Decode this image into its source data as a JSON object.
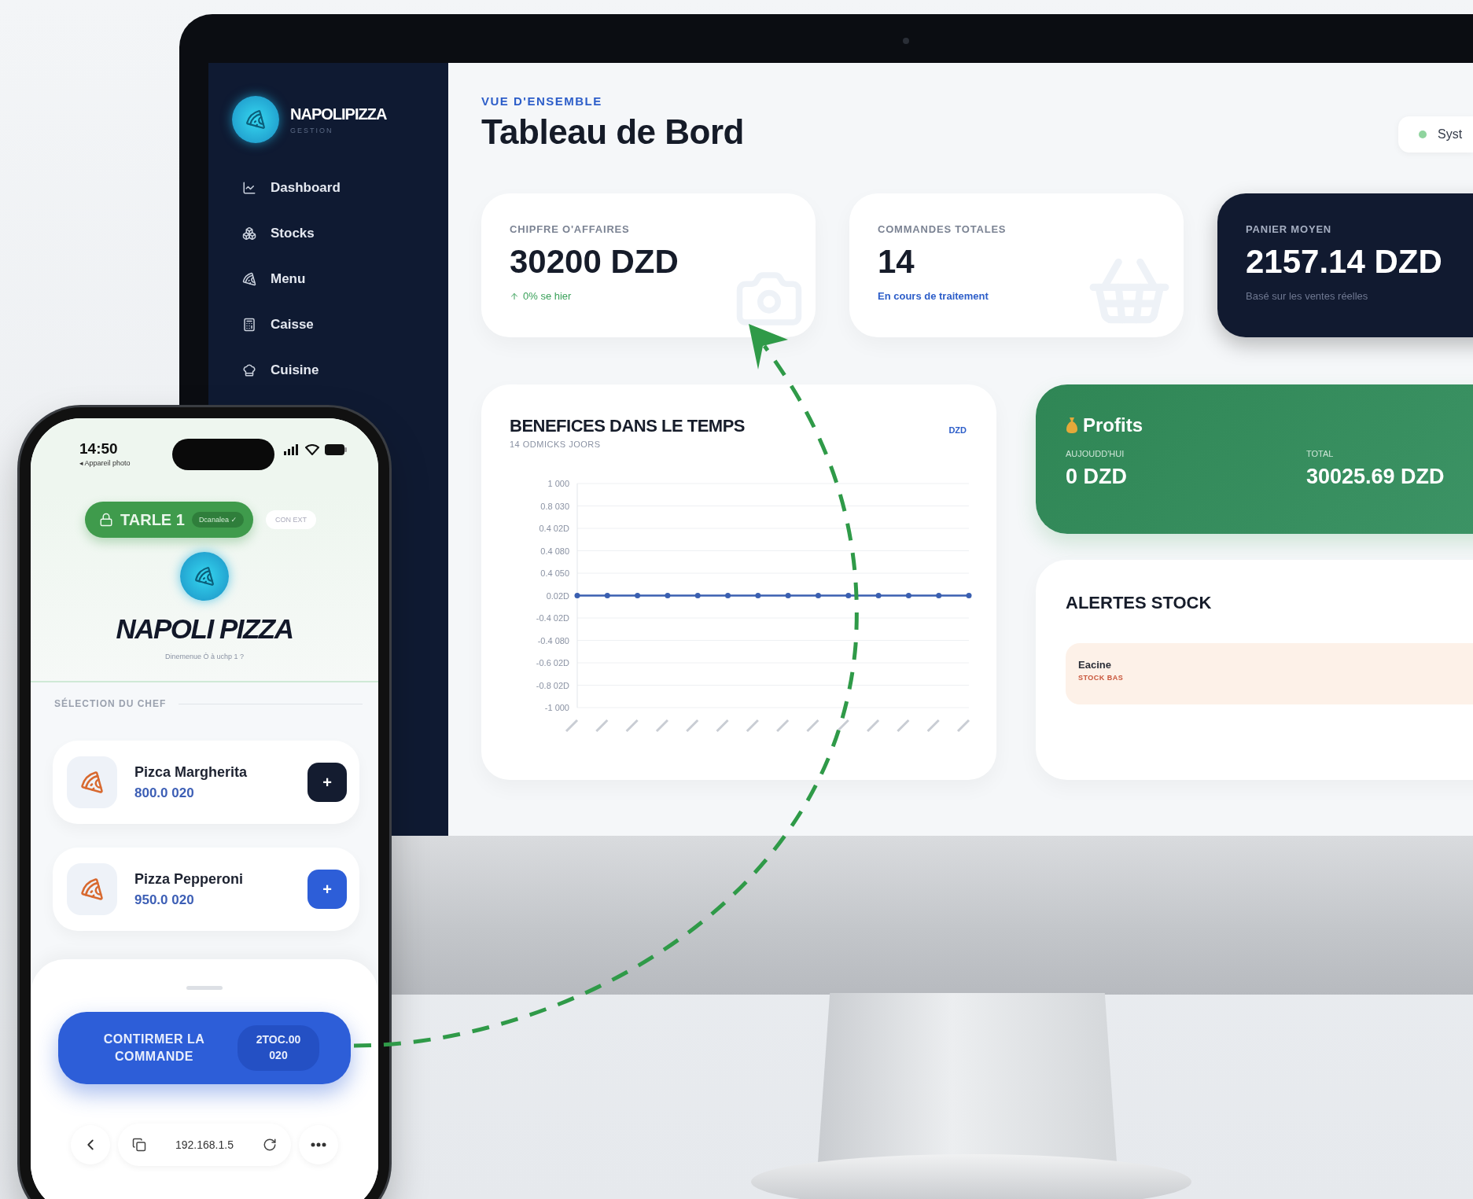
{
  "desktop": {
    "sidebar": {
      "brand": "NAPOLIPIZZA",
      "brand_subtitle": "GESTION",
      "items": [
        {
          "label": "Dashboard"
        },
        {
          "label": "Stocks"
        },
        {
          "label": "Menu"
        },
        {
          "label": "Caisse"
        },
        {
          "label": "Cuisine"
        }
      ]
    },
    "header": {
      "eyebrow": "VUE D'ENSEMBLE",
      "title": "Tableau de Bord",
      "status": "Syst"
    },
    "stats": [
      {
        "kind": "trend",
        "label": "CHIPFRE O'AFFAIRES",
        "value": "30200 DZD",
        "note": "0% se hier"
      },
      {
        "kind": "light",
        "label": "COMMANDES TOTALES",
        "value": "14",
        "note": "En cours de traitement"
      },
      {
        "kind": "dark",
        "label": "PANIER MOYEN",
        "value": "2157.14 DZD",
        "note": "Basé sur les ventes réelles"
      }
    ],
    "chart": {
      "title": "BENEFICES DANS LE TEMPS",
      "subtitle": "14 ODMICKS JOORS",
      "unit": "DZD",
      "y_labels": [
        "1 000",
        "0.8 030",
        "0.4 02D",
        "0.4 080",
        "0.4 050",
        "0.02D",
        "-0.4 02D",
        "-0.4 080",
        "-0.6 02D",
        "-0.8 02D",
        "-1 000"
      ]
    },
    "profits": {
      "title": "Profits",
      "today_label": "AUJOUDD'HUI",
      "today": "0 DZD",
      "total_label": "TOTAL",
      "total": "30025.69 DZD"
    },
    "alerts": {
      "title": "ALERTES STOCK",
      "items": [
        {
          "name": "Eacine",
          "status": "STOCK BAS"
        }
      ]
    }
  },
  "phone": {
    "time": "14:50",
    "back_app": "◂ Appareil photo",
    "table_label": "TARLE 1",
    "table_badge": "Dcanalea ✓",
    "connection": "CON EXT",
    "brand": "NAPOLI PIZZA",
    "welcome": "Dinemenue Ò à uchp 1 ?",
    "section": "SÉLECTION DU CHEF",
    "products": [
      {
        "name": "Pizca Margherita",
        "price": "800.0 020",
        "add": "+",
        "color": "#141c30"
      },
      {
        "name": "Pizza Pepperoni",
        "price": "950.0 020",
        "add": "+",
        "color": "#2d5ed8"
      }
    ],
    "confirm": {
      "label": "CONTIRMER LA COMMANDE",
      "amount": "2TOC.00 020"
    },
    "url": "192.168.1.5"
  }
}
